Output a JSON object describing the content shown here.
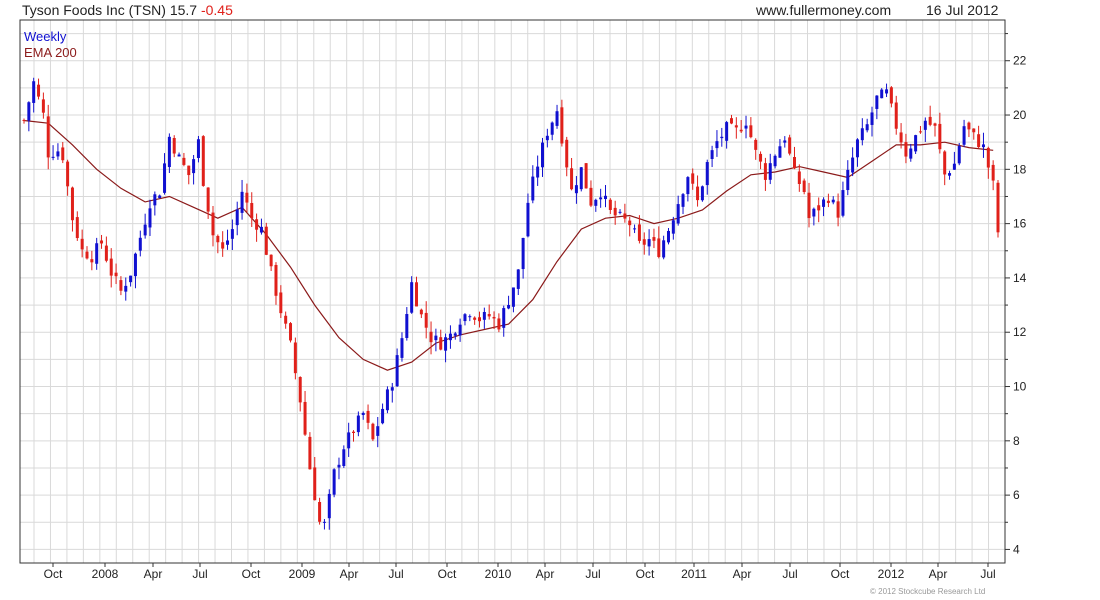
{
  "header": {
    "title_prefix": "Tyson Foods Inc (TSN) 15.7",
    "change": "-0.45",
    "site": "www.fullermoney.com",
    "date": "16 Jul 2012"
  },
  "colors": {
    "up": "#1010d0",
    "down": "#e0201a",
    "ema": "#8b1a1a",
    "grid": "#d9d9d9",
    "axis": "#333333"
  },
  "chart_data": {
    "type": "candlestick",
    "title": "Tyson Foods Inc (TSN) 15.7 -0.45",
    "frequency_label": "Weekly",
    "legend": [
      {
        "name": "Weekly",
        "color": "#1010d0"
      },
      {
        "name": "EMA 200",
        "color": "#8b1a1a"
      }
    ],
    "legend_placement": "top-left",
    "y_axis": {
      "position": "right",
      "ylim": [
        3.5,
        23.5
      ],
      "ticks": [
        4,
        6,
        8,
        10,
        12,
        14,
        16,
        18,
        20,
        22
      ],
      "grid": true
    },
    "x_axis": {
      "ticks": [
        "Oct",
        "2008",
        "Apr",
        "Jul",
        "Oct",
        "2009",
        "Apr",
        "Jul",
        "Oct",
        "2010",
        "Apr",
        "Jul",
        "Oct",
        "2011",
        "Apr",
        "Jul",
        "Oct",
        "2012",
        "Apr",
        "Jul"
      ],
      "grid": true
    },
    "series": [
      {
        "name": "Weekly",
        "kind": "candlestick",
        "approx_close_path": [
          [
            0,
            19.8
          ],
          [
            2,
            21.2
          ],
          [
            4,
            20.0
          ],
          [
            5,
            18.6
          ],
          [
            7,
            18.7
          ],
          [
            8,
            18.5
          ],
          [
            10,
            16.2
          ],
          [
            12,
            15.0
          ],
          [
            14,
            14.8
          ],
          [
            16,
            15.3
          ],
          [
            18,
            14.2
          ],
          [
            20,
            13.5
          ],
          [
            22,
            14.2
          ],
          [
            24,
            15.5
          ],
          [
            26,
            16.8
          ],
          [
            28,
            17.2
          ],
          [
            30,
            19.2
          ],
          [
            32,
            18.4
          ],
          [
            34,
            17.8
          ],
          [
            36,
            19.0
          ],
          [
            37,
            17.6
          ],
          [
            39,
            15.6
          ],
          [
            41,
            15.0
          ],
          [
            43,
            15.8
          ],
          [
            45,
            17.2
          ],
          [
            47,
            16.2
          ],
          [
            49,
            15.8
          ],
          [
            51,
            14.2
          ],
          [
            53,
            12.8
          ],
          [
            55,
            11.5
          ],
          [
            57,
            9.5
          ],
          [
            59,
            7.0
          ],
          [
            61,
            5.0
          ],
          [
            62,
            4.9
          ],
          [
            64,
            6.8
          ],
          [
            66,
            7.8
          ],
          [
            68,
            8.4
          ],
          [
            70,
            9.0
          ],
          [
            72,
            8.0
          ],
          [
            74,
            9.2
          ],
          [
            76,
            10.2
          ],
          [
            78,
            11.8
          ],
          [
            80,
            13.8
          ],
          [
            82,
            12.6
          ],
          [
            84,
            11.8
          ],
          [
            86,
            11.6
          ],
          [
            88,
            11.9
          ],
          [
            90,
            12.5
          ],
          [
            92,
            12.8
          ],
          [
            94,
            12.5
          ],
          [
            96,
            12.6
          ],
          [
            98,
            12.3
          ],
          [
            100,
            13.2
          ],
          [
            102,
            14.2
          ],
          [
            104,
            16.8
          ],
          [
            106,
            18.2
          ],
          [
            108,
            19.4
          ],
          [
            110,
            20.2
          ],
          [
            111,
            19.2
          ],
          [
            113,
            17.2
          ],
          [
            115,
            18.0
          ],
          [
            117,
            16.8
          ],
          [
            119,
            17.2
          ],
          [
            121,
            16.4
          ],
          [
            123,
            16.2
          ],
          [
            125,
            16.0
          ],
          [
            127,
            15.2
          ],
          [
            129,
            15.4
          ],
          [
            131,
            15.0
          ],
          [
            133,
            15.8
          ],
          [
            135,
            16.8
          ],
          [
            137,
            17.8
          ],
          [
            139,
            16.8
          ],
          [
            141,
            18.2
          ],
          [
            143,
            19.0
          ],
          [
            145,
            19.5
          ],
          [
            147,
            19.4
          ],
          [
            149,
            19.8
          ],
          [
            151,
            18.6
          ],
          [
            153,
            17.8
          ],
          [
            155,
            18.6
          ],
          [
            157,
            19.2
          ],
          [
            159,
            17.8
          ],
          [
            161,
            17.2
          ],
          [
            162,
            16.2
          ],
          [
            164,
            16.6
          ],
          [
            166,
            17.0
          ],
          [
            168,
            16.4
          ],
          [
            170,
            17.8
          ],
          [
            172,
            19.0
          ],
          [
            174,
            19.6
          ],
          [
            176,
            20.6
          ],
          [
            178,
            20.8
          ],
          [
            180,
            19.6
          ],
          [
            182,
            18.6
          ],
          [
            184,
            19.2
          ],
          [
            186,
            19.8
          ],
          [
            188,
            19.5
          ],
          [
            190,
            17.8
          ],
          [
            192,
            18.2
          ],
          [
            194,
            19.6
          ],
          [
            196,
            19.2
          ],
          [
            198,
            18.8
          ],
          [
            200,
            17.4
          ],
          [
            201,
            15.7
          ]
        ]
      },
      {
        "name": "EMA 200",
        "kind": "line",
        "values": [
          [
            0,
            19.8
          ],
          [
            5,
            19.7
          ],
          [
            10,
            18.9
          ],
          [
            15,
            18.0
          ],
          [
            20,
            17.3
          ],
          [
            25,
            16.8
          ],
          [
            30,
            17.0
          ],
          [
            35,
            16.6
          ],
          [
            40,
            16.2
          ],
          [
            45,
            16.6
          ],
          [
            50,
            15.6
          ],
          [
            55,
            14.4
          ],
          [
            60,
            13.0
          ],
          [
            65,
            11.8
          ],
          [
            70,
            11.0
          ],
          [
            75,
            10.6
          ],
          [
            80,
            10.9
          ],
          [
            85,
            11.6
          ],
          [
            90,
            11.9
          ],
          [
            95,
            12.1
          ],
          [
            100,
            12.3
          ],
          [
            105,
            13.2
          ],
          [
            110,
            14.6
          ],
          [
            115,
            15.8
          ],
          [
            120,
            16.2
          ],
          [
            125,
            16.3
          ],
          [
            130,
            16.0
          ],
          [
            135,
            16.2
          ],
          [
            140,
            16.5
          ],
          [
            145,
            17.2
          ],
          [
            150,
            17.8
          ],
          [
            155,
            17.9
          ],
          [
            160,
            18.1
          ],
          [
            165,
            17.9
          ],
          [
            170,
            17.7
          ],
          [
            175,
            18.3
          ],
          [
            180,
            18.9
          ],
          [
            185,
            18.9
          ],
          [
            190,
            19.0
          ],
          [
            195,
            18.8
          ],
          [
            200,
            18.7
          ]
        ]
      }
    ],
    "x_index_range": [
      0,
      201
    ]
  },
  "footer": {
    "copyright": "© 2012 Stockcube Research Ltd"
  }
}
